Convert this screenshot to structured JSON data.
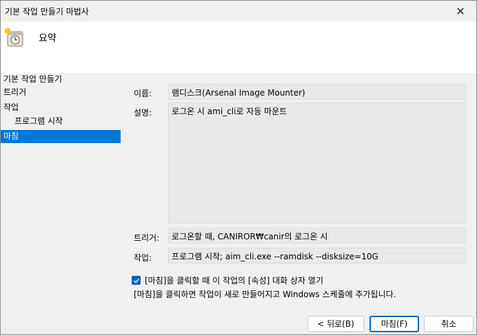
{
  "window": {
    "title": "기본 작업 만들기 마법사",
    "close_glyph": "✕"
  },
  "header": {
    "heading": "요약",
    "icon": "task-scheduler-icon"
  },
  "sidebar": {
    "items": [
      {
        "label": "기본 작업 만들기"
      },
      {
        "label": "트리거"
      },
      {
        "label": "작업"
      },
      {
        "label": "프로그램 시작"
      },
      {
        "label": "마침"
      }
    ]
  },
  "summary": {
    "name_label": "이름:",
    "name_value": "램디스크(Arsenal Image Mounter)",
    "description_label": "설명:",
    "description_value": "로그온 시 ami_cli로 자동 마운트",
    "trigger_label": "트리거:",
    "trigger_value": "로그온할 때, CANIROR₩canir의 로그온 시",
    "action_label": "작업:",
    "action_value": "프로그램 시작; aim_cli.exe --ramdisk --disksize=10G"
  },
  "options": {
    "open_properties_label": "[마침]을 클릭할 때 이 작업의 [속성] 대화 상자 열기",
    "open_properties_checked": true,
    "info_text": "[마침]을 클릭하면 작업이 새로 만들어지고 Windows 스케줄에 추가됩니다."
  },
  "buttons": {
    "back_label": "< 뒤로(B)",
    "finish_label": "마침(F)",
    "cancel_label": "취소"
  },
  "colors": {
    "accent": "#0078d7",
    "checkbox": "#0067c0"
  }
}
